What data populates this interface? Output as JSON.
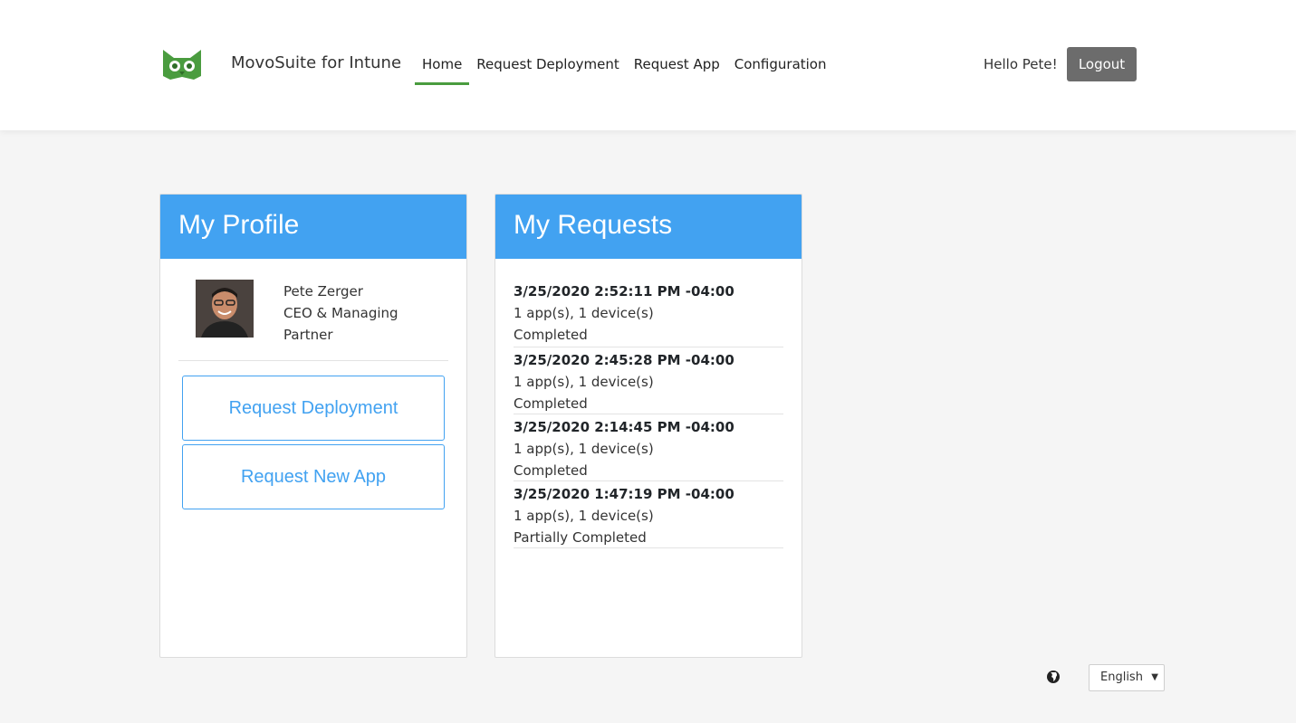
{
  "header": {
    "brand": "MovoSuite for Intune",
    "nav": [
      "Home",
      "Request Deployment",
      "Request App",
      "Configuration"
    ],
    "active_nav": "Home",
    "greeting": "Hello Pete!",
    "logout_label": "Logout",
    "logo_icon": "owl-logo-icon",
    "accent_color": "#4a9c3f"
  },
  "profile": {
    "title": "My Profile",
    "name": "Pete Zerger",
    "role_line1": "CEO & Managing",
    "role_line2": "Partner",
    "buttons": [
      "Request Deployment",
      "Request New App"
    ]
  },
  "requests": {
    "title": "My Requests",
    "items": [
      {
        "date": "3/25/2020 2:52:11 PM -04:00",
        "summary": "1 app(s), 1 device(s)",
        "status": "Completed"
      },
      {
        "date": "3/25/2020 2:45:28 PM -04:00",
        "summary": "1 app(s), 1 device(s)",
        "status": "Completed"
      },
      {
        "date": "3/25/2020 2:14:45 PM -04:00",
        "summary": "1 app(s), 1 device(s)",
        "status": "Completed"
      },
      {
        "date": "3/25/2020 1:47:19 PM -04:00",
        "summary": "1 app(s), 1 device(s)",
        "status": "Partially Completed"
      }
    ]
  },
  "footer": {
    "language": "English",
    "globe_icon": "globe-icon"
  },
  "colors": {
    "card_header": "#42a2f1",
    "logout_button": "#6c6c6c",
    "background": "#f5f5f5"
  }
}
